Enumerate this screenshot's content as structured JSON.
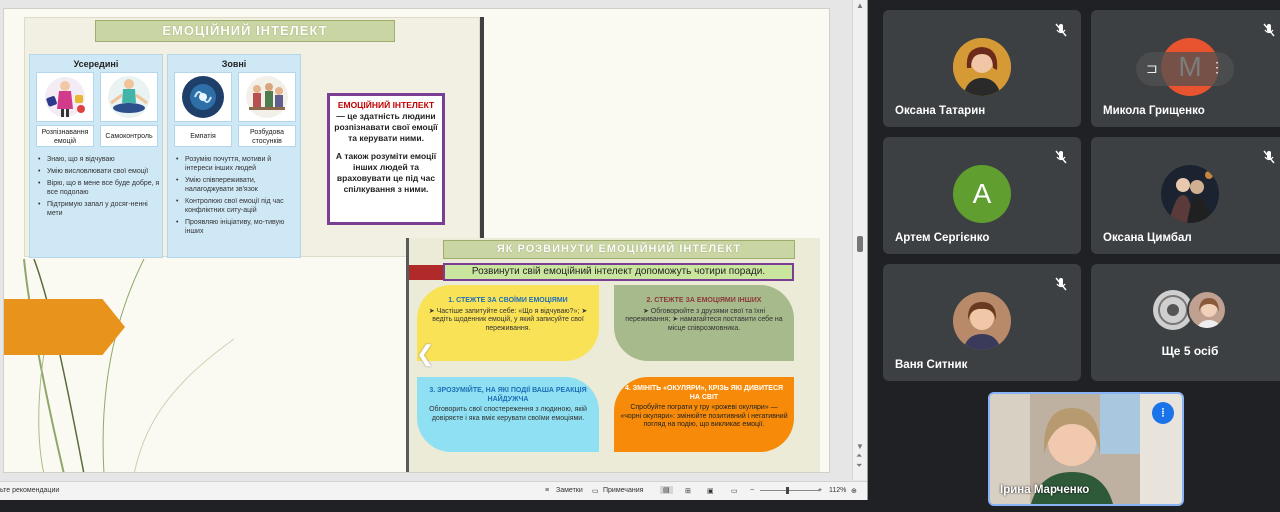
{
  "slide": {
    "main_title": "ЕМОЦІЙНИЙ ІНТЕЛЕКТ",
    "inside": {
      "heading": "Усередині",
      "items": [
        {
          "label": "Розпізнавання емоцій",
          "icon": "emotions-icon"
        },
        {
          "label": "Самоконтроль",
          "icon": "meditation-icon"
        }
      ],
      "bullets": [
        "Знаю, що я відчуваю",
        "Умію висловлювати свої емоції",
        "Вірю, що в мене все буде добре, я все подолаю",
        "Підтримую запал у досяг-ненні мети"
      ]
    },
    "outside": {
      "heading": "Зовні",
      "items": [
        {
          "label": "Емпатія",
          "icon": "brain-icon"
        },
        {
          "label": "Розбудова стосунків",
          "icon": "people-icon"
        }
      ],
      "bullets": [
        "Розумію почуття, мотиви й інтереси інших людей",
        "Умію співпереживати, налагоджувати зв'язок",
        "Контролюю свої емоції під час конфліктних ситу-ацій",
        "Проявляю ініціативу, мо-тивую інших"
      ]
    },
    "definition": {
      "title": "ЕМОЦІЙНИЙ ІНТЕЛЕКТ",
      "text1": "— це здатність людини розпізнавати свої емоції та керувати ними.",
      "text2": "А також розуміти емоції інших людей та враховувати це під час спілкування з ними."
    },
    "how": {
      "title": "ЯК РОЗВИНУТИ ЕМОЦІЙНИЙ ІНТЕЛЕКТ",
      "subtitle": "Розвинути свій емоційний інтелект допоможуть чотири поради.",
      "tips": [
        {
          "title": "1. СТЕЖТЕ ЗА СВОЇМИ ЕМОЦІЯМИ",
          "text": "➤ Частіше запитуйте себе: «Що я відчуваю?»; ➤ ведіть щоденник емоцій, у який записуйте свої переживання."
        },
        {
          "title": "2. СТЕЖТЕ ЗА ЕМОЦІЯМИ ІНШИХ",
          "text": "➤ Обговорюйте з друзями свої та їхні переживання; ➤ намагайтеся поставити себе на місце співрозмовника."
        },
        {
          "title": "3. ЗРОЗУМІЙТЕ, НА ЯКІ ПОДІЇ ВАША РЕАКЦІЯ НАЙДУЖЧА",
          "text": "Обговорить свої спостереження з людиною, якій довіряєте і яка вміє керувати своїми емоціями."
        },
        {
          "title": "4. ЗМІНІТЬ «ОКУЛЯРИ», КРІЗЬ ЯКІ ДИВИТЕСЯ НА СВІТ",
          "text": "Спробуйте пограти у гру «рожеві окуляри» — «чорні окуляри»: змінюйте позитивний і негативний погляд на подію, що викликає емоції."
        }
      ]
    }
  },
  "statusbar": {
    "left": "ьте рекомендации",
    "notes": "Заметки",
    "comments": "Примечания",
    "zoom": "112%",
    "minus": "−",
    "plus": "+"
  },
  "participants": [
    {
      "name": "Оксана Татарин",
      "avatar": "photo"
    },
    {
      "name": "Микола Грищенко",
      "avatar": "letter",
      "letter": "М",
      "color": "#e8542f"
    },
    {
      "name": "Артем Сергієнко",
      "avatar": "letter",
      "letter": "А",
      "color": "#5f9e2f"
    },
    {
      "name": "Оксана Цимбал",
      "avatar": "photo"
    },
    {
      "name": "Ваня Ситник",
      "avatar": "photo"
    },
    {
      "name": "Ще 5 осіб",
      "avatar": "group"
    }
  ],
  "self_view": {
    "name": "Ірина Марченко"
  },
  "colors": {
    "meet_bg": "#202124",
    "tile_bg": "#3c4043",
    "accent_blue": "#8ab4f8"
  }
}
